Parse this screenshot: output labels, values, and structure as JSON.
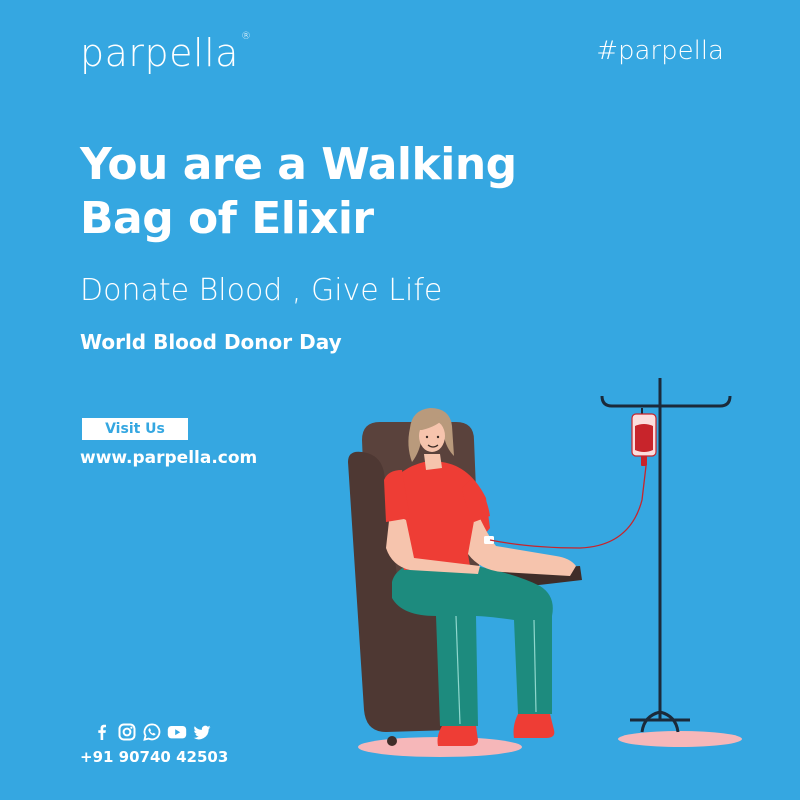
{
  "brand": {
    "name": "parpella",
    "registered_mark": "®"
  },
  "hashtag": "#parpella",
  "headline": {
    "line1": "You are a Walking",
    "line2": "Bag of Elixir"
  },
  "subheadline": "Donate Blood , Give Life",
  "event_name": "World Blood Donor Day",
  "cta": {
    "visit_label": "Visit Us",
    "website": "www.parpella.com"
  },
  "socials": [
    "facebook-icon",
    "instagram-icon",
    "whatsapp-icon",
    "youtube-icon",
    "twitter-icon"
  ],
  "contact": {
    "phone": "+91 90740 42503"
  },
  "colors": {
    "background": "#35a7e1",
    "text": "#ffffff",
    "shirt": "#ee3d35",
    "pants": "#1d8b7e",
    "chair": "#5a423c",
    "blood": "#c8242b",
    "stand": "#1b2a3a",
    "floor_shadow": "#f6b7b9"
  }
}
